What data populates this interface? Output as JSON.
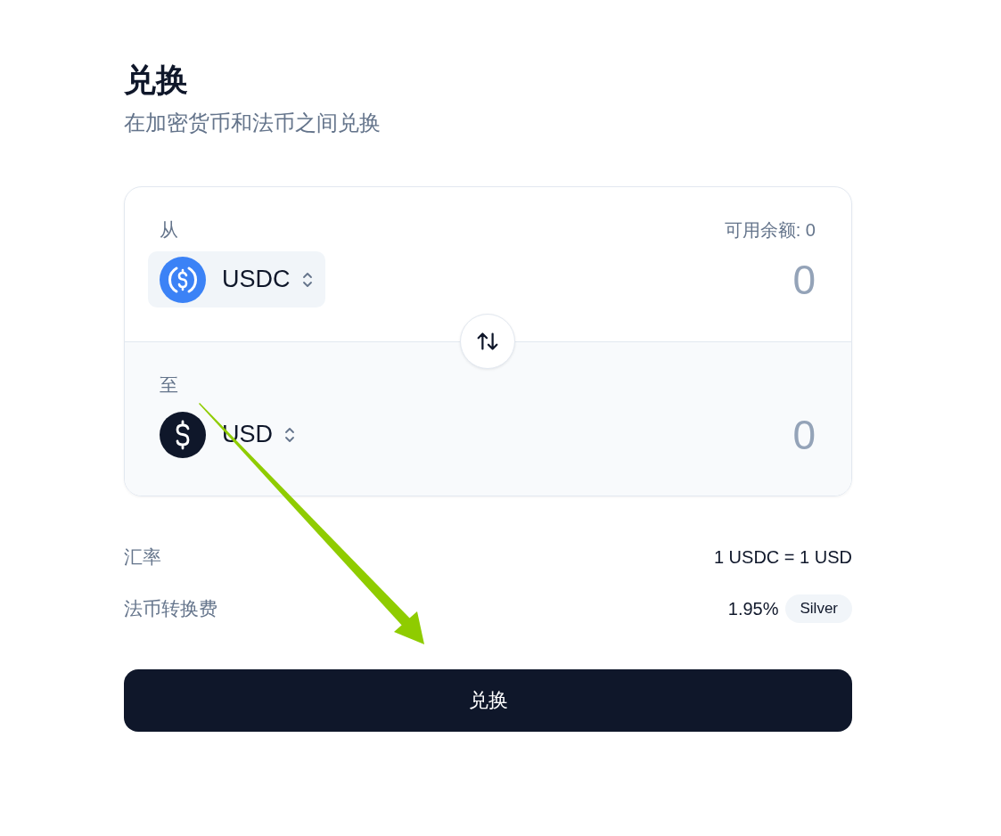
{
  "header": {
    "title": "兑换",
    "subtitle": "在加密货币和法币之间兑换"
  },
  "sections": [
    {
      "kind": "from",
      "label": "从",
      "balance": "可用余额: 0",
      "token": {
        "symbol": "USDC"
      },
      "amount": "0"
    },
    {
      "kind": "to",
      "label": "至",
      "token": {
        "symbol": "USD"
      },
      "amount": "0"
    }
  ],
  "details": [
    {
      "label": "汇率",
      "value": "1 USDC = 1 USD"
    },
    {
      "label": "法币转换费",
      "value": "1.95%",
      "badge": "Silver"
    }
  ],
  "submit": "兑换"
}
